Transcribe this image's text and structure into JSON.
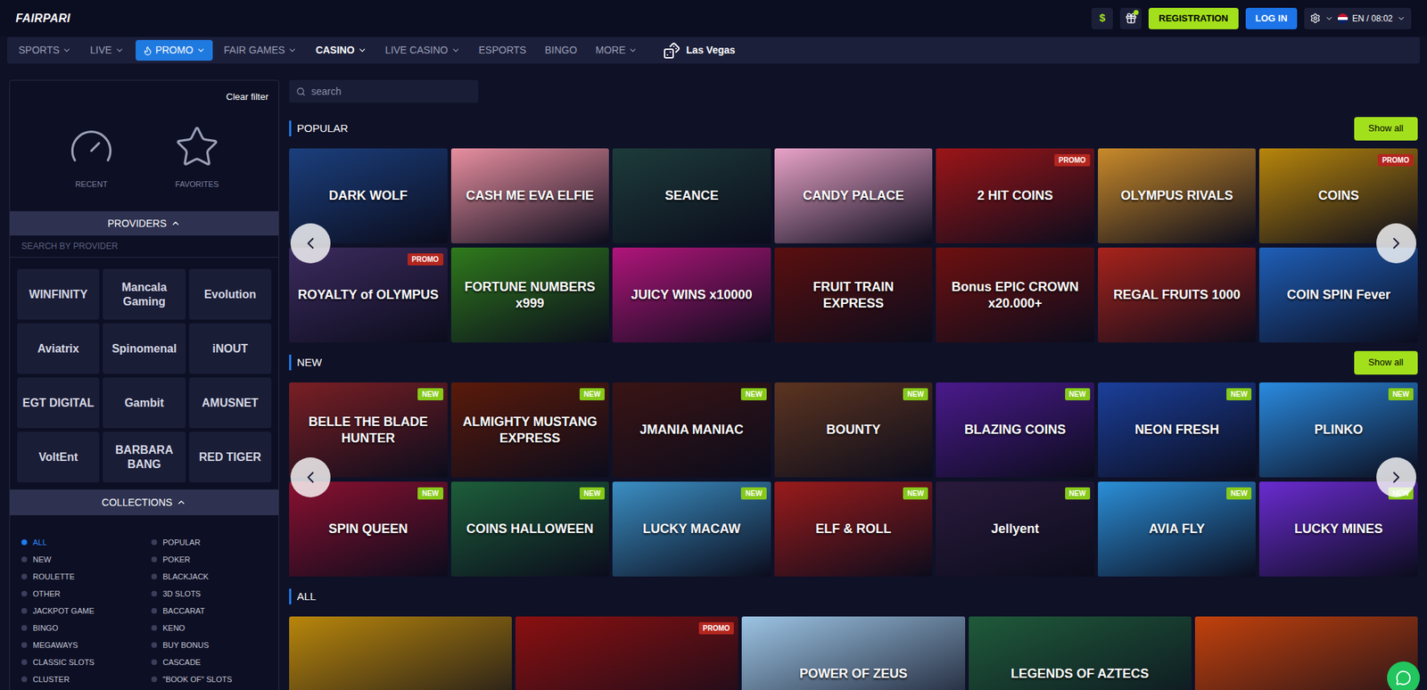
{
  "header": {
    "logo": "FAIRPARI",
    "currency": "$",
    "gift_notification": true,
    "register": "REGISTRATION",
    "login": "LOG IN",
    "language": "EN / 08:02"
  },
  "nav": [
    {
      "label": "SPORTS",
      "dropdown": true,
      "selected": false,
      "highlighted": false
    },
    {
      "label": "LIVE",
      "dropdown": true,
      "selected": false,
      "highlighted": false
    },
    {
      "label": "PROMO",
      "dropdown": true,
      "selected": false,
      "highlighted": true
    },
    {
      "label": "FAIR GAMES",
      "dropdown": true,
      "selected": false,
      "highlighted": false
    },
    {
      "label": "CASINO",
      "dropdown": true,
      "selected": true,
      "highlighted": false
    },
    {
      "label": "LIVE CASINO",
      "dropdown": true,
      "selected": false,
      "highlighted": false
    },
    {
      "label": "ESPORTS",
      "dropdown": false,
      "selected": false,
      "highlighted": false
    },
    {
      "label": "BINGO",
      "dropdown": false,
      "selected": false,
      "highlighted": false
    },
    {
      "label": "MORE",
      "dropdown": true,
      "selected": false,
      "highlighted": false
    }
  ],
  "nav_extra": {
    "label": "Las Vegas"
  },
  "sidebar": {
    "clear_filter": "Clear filter",
    "shortcuts": [
      "RECENT",
      "FAVORITES"
    ],
    "providers": {
      "title": "PROVIDERS",
      "expanded": true,
      "search_placeholder": "SEARCH BY PROVIDER",
      "items": [
        "WINFINITY",
        "Mancala Gaming",
        "Evolution",
        "Aviatrix",
        "Spinomenal",
        "iNOUT",
        "EGT DIGITAL",
        "Gambit",
        "AMUSNET",
        "VoltEnt",
        "BARBARA BANG",
        "RED TIGER"
      ]
    },
    "collections": {
      "title": "COLLECTIONS",
      "expanded": true,
      "items": [
        {
          "label": "ALL",
          "selected": true
        },
        {
          "label": "POPULAR",
          "selected": false
        },
        {
          "label": "NEW",
          "selected": false
        },
        {
          "label": "POKER",
          "selected": false
        },
        {
          "label": "ROULETTE",
          "selected": false
        },
        {
          "label": "BLACKJACK",
          "selected": false
        },
        {
          "label": "OTHER",
          "selected": false
        },
        {
          "label": "3D SLOTS",
          "selected": false
        },
        {
          "label": "JACKPOT GAME",
          "selected": false
        },
        {
          "label": "BACCARAT",
          "selected": false
        },
        {
          "label": "BINGO",
          "selected": false
        },
        {
          "label": "KENO",
          "selected": false
        },
        {
          "label": "MEGAWAYS",
          "selected": false
        },
        {
          "label": "BUY BONUS",
          "selected": false
        },
        {
          "label": "CLASSIC SLOTS",
          "selected": false
        },
        {
          "label": "CASCADE",
          "selected": false
        },
        {
          "label": "CLUSTER",
          "selected": false
        },
        {
          "label": "\"BOOK OF\" SLOTS",
          "selected": false
        }
      ]
    }
  },
  "search": {
    "placeholder": "search"
  },
  "sections": [
    {
      "title": "POPULAR",
      "kind": "carousel",
      "show_all": "Show all",
      "games": [
        {
          "title": "DARK WOLF",
          "badge": "",
          "color": "#1b3f7d"
        },
        {
          "title": "CASH ME EVA ELFIE",
          "badge": "",
          "color": "#e88fa0"
        },
        {
          "title": "SEANCE",
          "badge": "",
          "color": "#1d3b3a"
        },
        {
          "title": "CANDY PALACE",
          "badge": "",
          "color": "#e9a3c8"
        },
        {
          "title": "2 HIT COINS",
          "badge": "PROMO",
          "color": "#9c1518"
        },
        {
          "title": "OLYMPUS RIVALS",
          "badge": "",
          "color": "#c98a2a"
        },
        {
          "title": "COINS",
          "badge": "PROMO",
          "color": "#b8860b"
        },
        {
          "title": "ROYALTY of OLYMPUS",
          "badge": "PROMO",
          "color": "#3c2b5e"
        },
        {
          "title": "FORTUNE NUMBERS x999",
          "badge": "",
          "color": "#2f7a1c"
        },
        {
          "title": "JUICY WINS x10000",
          "badge": "",
          "color": "#b0157a"
        },
        {
          "title": "FRUIT TRAIN EXPRESS",
          "badge": "",
          "color": "#5a0f0f"
        },
        {
          "title": "Bonus EPIC CROWN x20.000+",
          "badge": "",
          "color": "#6e1010"
        },
        {
          "title": "REGAL FRUITS 1000",
          "badge": "",
          "color": "#a8231b"
        },
        {
          "title": "COIN SPIN Fever",
          "badge": "",
          "color": "#1f5fb8"
        }
      ]
    },
    {
      "title": "NEW",
      "kind": "carousel",
      "show_all": "Show all",
      "games": [
        {
          "title": "BELLE THE BLADE HUNTER",
          "badge": "NEW",
          "color": "#7a1f24"
        },
        {
          "title": "ALMIGHTY MUSTANG EXPRESS",
          "badge": "NEW",
          "color": "#5a1a0a"
        },
        {
          "title": "JMANIA MANIAC",
          "badge": "NEW",
          "color": "#3a1414"
        },
        {
          "title": "BOUNTY",
          "badge": "NEW",
          "color": "#5c3420"
        },
        {
          "title": "BLAZING COINS",
          "badge": "NEW",
          "color": "#4a1a8c"
        },
        {
          "title": "NEON FRESH",
          "badge": "NEW",
          "color": "#1b3f9a"
        },
        {
          "title": "PLINKO",
          "badge": "NEW",
          "color": "#2a8be0"
        },
        {
          "title": "SPIN QUEEN",
          "badge": "NEW",
          "color": "#8a1030"
        },
        {
          "title": "COINS HALLOWEEN",
          "badge": "NEW",
          "color": "#1d5e3a"
        },
        {
          "title": "LUCKY MACAW",
          "badge": "NEW",
          "color": "#3b8fc4"
        },
        {
          "title": "ELF & ROLL",
          "badge": "NEW",
          "color": "#9a1b1b"
        },
        {
          "title": "Jellyent",
          "badge": "NEW",
          "color": "#2a1a3c"
        },
        {
          "title": "AVIA FLY",
          "badge": "NEW",
          "color": "#2b8fd8"
        },
        {
          "title": "LUCKY MINES",
          "badge": "NEW",
          "color": "#6a2bd0"
        }
      ]
    },
    {
      "title": "ALL",
      "kind": "grid",
      "show_all": "",
      "games": [
        {
          "title": "",
          "badge": "",
          "color": "#b8860b"
        },
        {
          "title": "",
          "badge": "PROMO",
          "color": "#8a1010"
        },
        {
          "title": "POWER OF ZEUS",
          "badge": "",
          "color": "#9cc4e4"
        },
        {
          "title": "LEGENDS OF AZTECS",
          "badge": "",
          "color": "#1f5a3a"
        },
        {
          "title": "",
          "badge": "",
          "color": "#c2410c"
        }
      ]
    }
  ]
}
